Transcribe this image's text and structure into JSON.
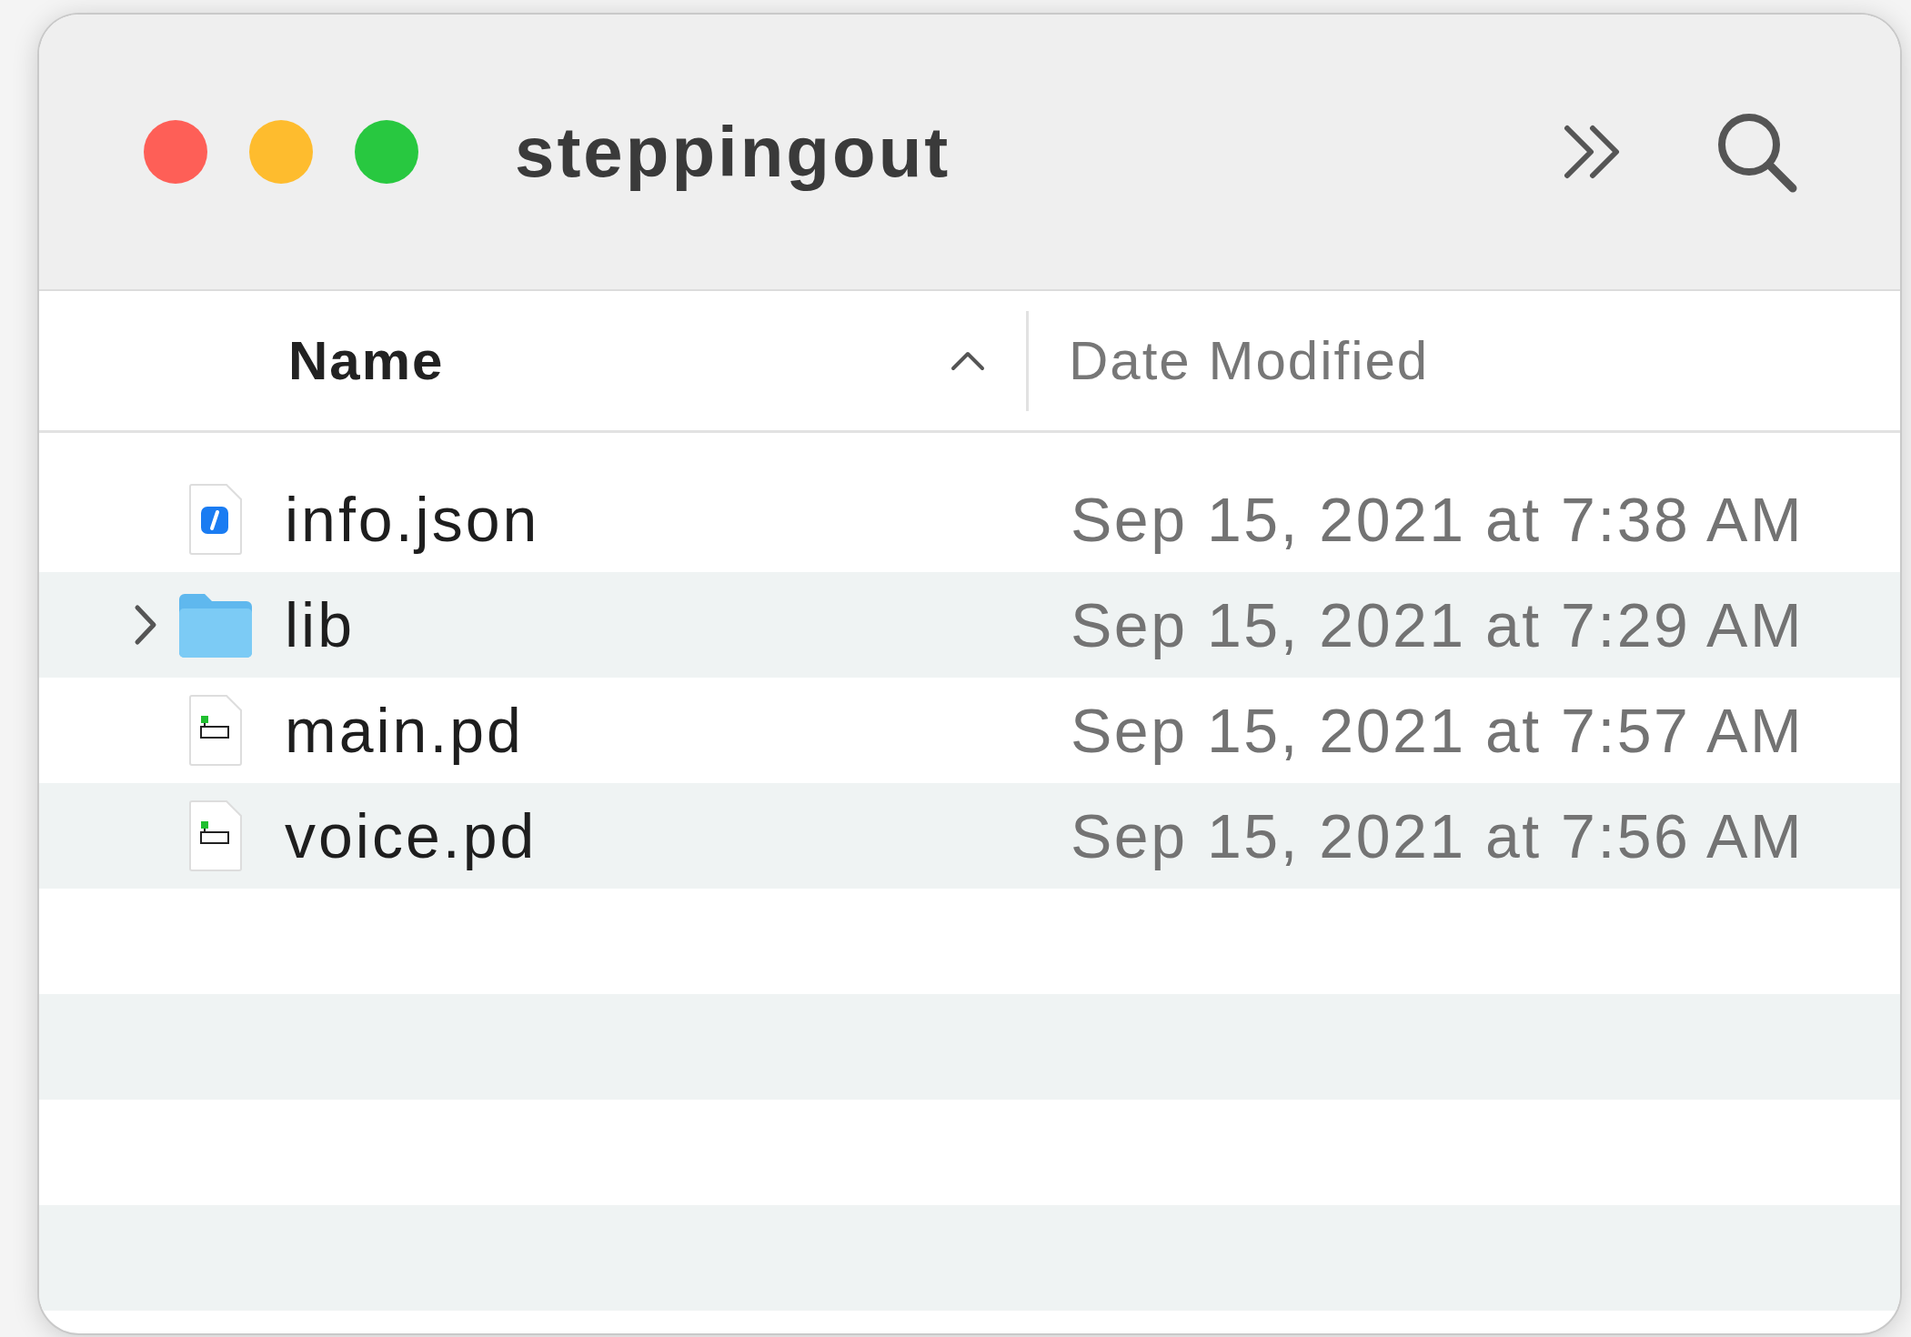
{
  "window": {
    "title": "steppingout"
  },
  "columns": [
    {
      "label": "Name",
      "sorted": true
    },
    {
      "label": "Date Modified",
      "sorted": false
    }
  ],
  "rows": [
    {
      "kind": "json",
      "name": "info.json",
      "date": "Sep 15, 2021 at 7:38 AM"
    },
    {
      "kind": "folder",
      "name": "lib",
      "date": "Sep 15, 2021 at 7:29 AM"
    },
    {
      "kind": "pd",
      "name": "main.pd",
      "date": "Sep 15, 2021 at 7:57 AM"
    },
    {
      "kind": "pd",
      "name": "voice.pd",
      "date": "Sep 15, 2021 at 7:56 AM"
    }
  ]
}
